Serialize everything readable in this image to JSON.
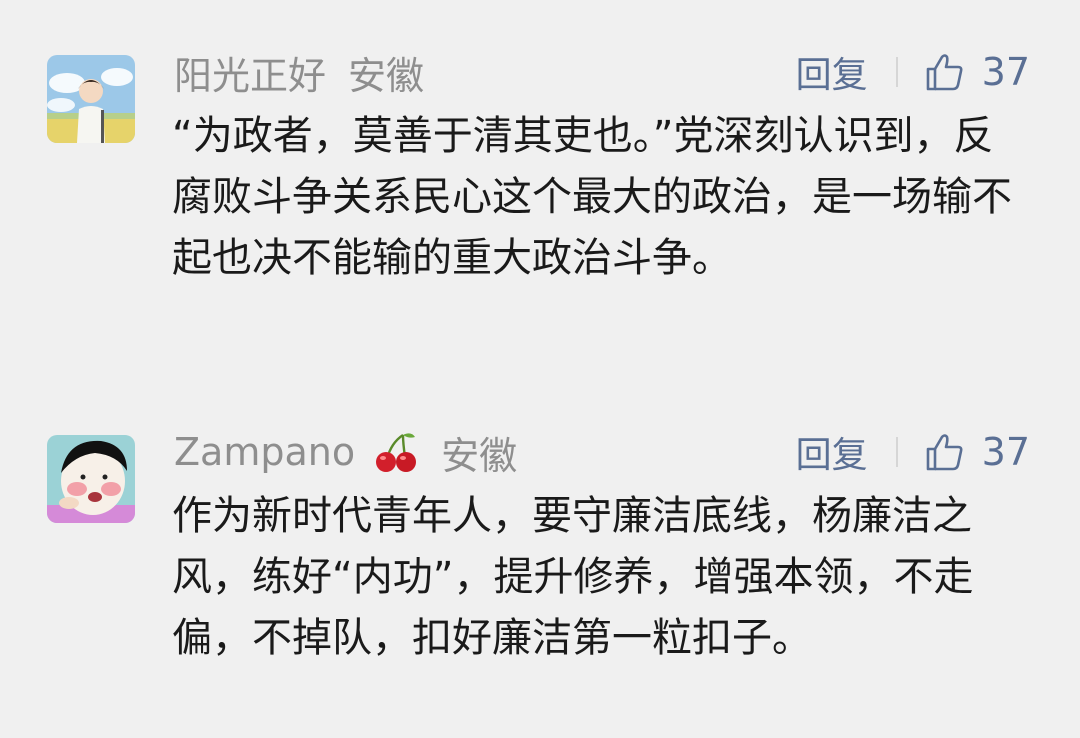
{
  "comments": [
    {
      "username": "阳光正好",
      "location": "安徽",
      "reply_label": "回复",
      "likes": "37",
      "text": "“为政者，莫善于清其吏也。”党深刻认识到，反腐败斗争关系民心这个最大的政治，是一场输不起也决不能输的重大政治斗争。",
      "avatar_icon": "anime-boy-avatar"
    },
    {
      "username": "Zampano",
      "location": "安徽",
      "reply_label": "回复",
      "likes": "37",
      "text": "作为新时代青年人，要守廉洁底线，杨廉洁之风，练好“内功”，提升修养，增强本领，不走偏，不掉队，扣好廉洁第一粒扣子。",
      "avatar_icon": "cartoon-face-avatar",
      "badge_icon": "cherry-icon"
    }
  ],
  "colors": {
    "username": "#8e8e8e",
    "action": "#5a6f94",
    "text": "#1a1a1a",
    "background": "#f0f0f0"
  }
}
